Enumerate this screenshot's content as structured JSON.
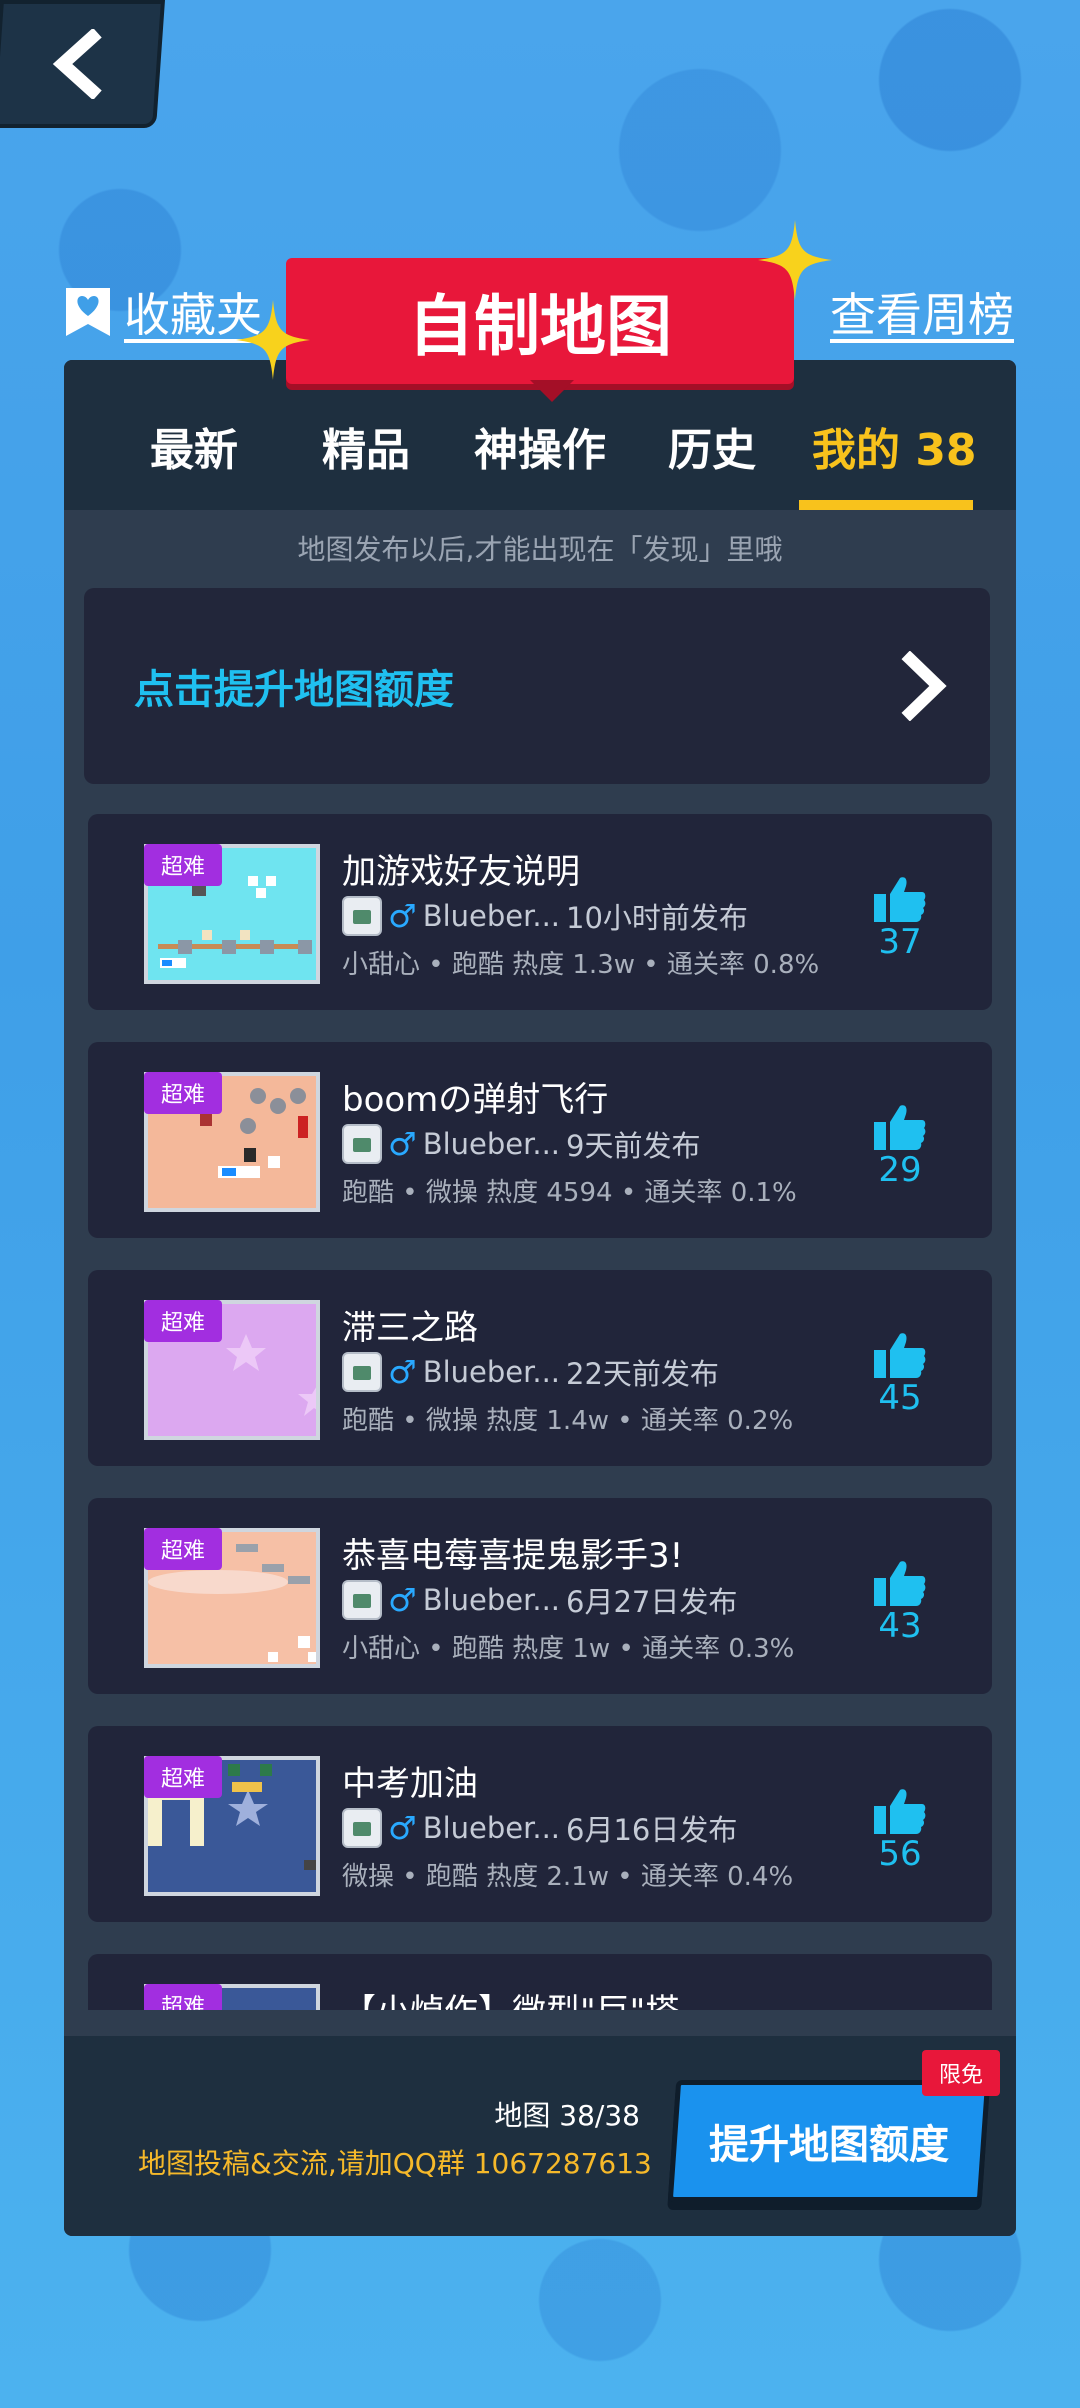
{
  "colors": {
    "background": "#45a8ea",
    "panel": "#2f3d4f",
    "tab_active": "#f8c21c",
    "accent_cyan": "#1fc0f0",
    "title_red": "#e8173a",
    "badge_purple": "#a22ee0",
    "qq_text": "#f6b92a"
  },
  "header": {
    "back_icon": "chevron-left-icon",
    "favorites_label": "收藏夹",
    "favorites_icon": "heart-bookmark-icon",
    "title": "自制地图",
    "weekly_label": "查看周榜"
  },
  "tabs": [
    {
      "label": "最新",
      "active": false
    },
    {
      "label": "精品",
      "active": false
    },
    {
      "label": "神操作",
      "active": false
    },
    {
      "label": "历史",
      "active": false
    },
    {
      "label": "我的 38",
      "active": true
    }
  ],
  "hint": "地图发布以后,才能出现在「发现」里哦",
  "quota": {
    "label": "点击提升地图额度",
    "icon": "chevron-right-icon"
  },
  "maps": [
    {
      "badge": "超难",
      "title": "加游戏好友说明",
      "author": "Blueber...",
      "time": "10小时前发布",
      "tags": "小甜心 • 跑酷 热度 1.3w • 通关率 0.8%",
      "likes": "37",
      "thumb": "sky"
    },
    {
      "badge": "超难",
      "title": "boomの弹射飞行",
      "author": "Blueber...",
      "time": "9天前发布",
      "tags": "跑酷 • 微操 热度 4594 • 通关率 0.1%",
      "likes": "29",
      "thumb": "peach"
    },
    {
      "badge": "超难",
      "title": "滞三之路",
      "author": "Blueber...",
      "time": "22天前发布",
      "tags": "跑酷 • 微操 热度 1.4w • 通关率 0.2%",
      "likes": "45",
      "thumb": "violet"
    },
    {
      "badge": "超难",
      "title": "恭喜电莓喜提鬼影手3!",
      "author": "Blueber...",
      "time": "6月27日发布",
      "tags": "小甜心 • 跑酷 热度 1w • 通关率 0.3%",
      "likes": "43",
      "thumb": "salmon"
    },
    {
      "badge": "超难",
      "title": "中考加油",
      "author": "Blueber...",
      "time": "6月16日发布",
      "tags": "微操 • 跑酷 热度 2.1w • 通关率 0.4%",
      "likes": "56",
      "thumb": "navy"
    },
    {
      "badge": "超难",
      "title": "【小焯作】微型\"巨\"塔",
      "author": "",
      "time": "",
      "tags": "",
      "likes": "",
      "thumb": "navy"
    }
  ],
  "footer": {
    "map_count": "地图 38/38",
    "qq_text": "地图投稿&交流,请加QQ群 1067287613",
    "upgrade_label": "提升地图额度",
    "free_badge": "限免"
  }
}
